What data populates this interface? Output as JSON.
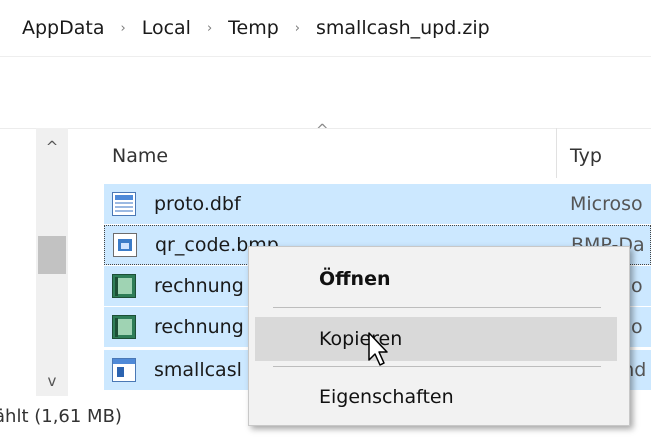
{
  "breadcrumb": {
    "items": [
      "AppData",
      "Local",
      "Temp",
      "smallcash_upd.zip"
    ],
    "separator": "›"
  },
  "columns": {
    "name": "Name",
    "type": "Typ"
  },
  "files": [
    {
      "name": "proto.dbf",
      "type": "Microso",
      "icon": "database-file-icon"
    },
    {
      "name": "qr_code.bmp",
      "type": "BMP-Da",
      "icon": "bitmap-image-icon"
    },
    {
      "name": "rechnung",
      "type": "Microso",
      "icon": "document-book-icon"
    },
    {
      "name": "rechnung",
      "type": "Microso",
      "icon": "document-book-icon"
    },
    {
      "name": "smallcasl",
      "type": "Anwend",
      "icon": "application-icon"
    }
  ],
  "status": {
    "text": "ählt (1,61 MB)"
  },
  "context_menu": {
    "open": "Öffnen",
    "copy": "Kopieren",
    "properties": "Eigenschaften"
  },
  "colors": {
    "selection": "#cce8ff",
    "menu_bg": "#f2f2f2",
    "menu_hover": "#d9d9d9"
  }
}
